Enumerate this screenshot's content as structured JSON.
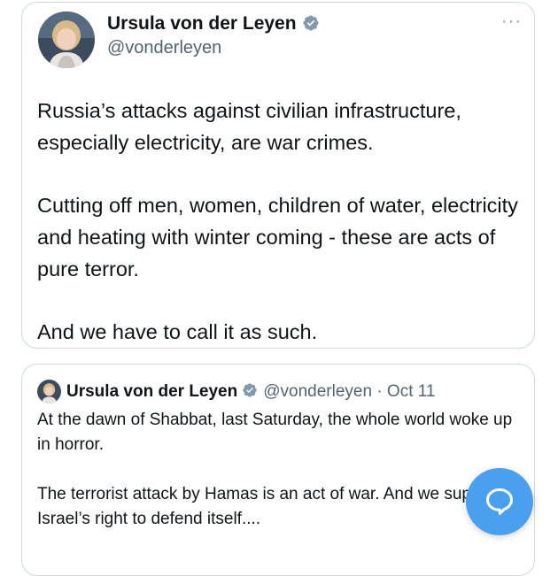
{
  "tweet": {
    "author_name": "Ursula von der Leyen",
    "handle": "@vonderleyen",
    "more_label": "···",
    "paragraphs": [
      "Russia’s attacks against civilian infrastructure, especially electricity, are war crimes.",
      "Cutting off men, women, children of water, electricity and heating with winter coming - these are acts of pure terror.",
      "And we have to call it as such."
    ]
  },
  "quoted_tweet": {
    "author_name": "Ursula von der Leyen",
    "handle_date": "@vonderleyen · Oct 11",
    "paragraphs": [
      "At the dawn of Shabbat, last Saturday, the whole world woke up in horror.",
      "The terrorist attack by Hamas is an act of war. And we support Israel’s right to defend itself...."
    ]
  },
  "icons": {
    "verified": "verified-badge-icon",
    "more": "more-options-icon",
    "fab": "chat-bubble-icon"
  },
  "colors": {
    "verified_badge": "#829aab",
    "fab": "#4aa0ec",
    "secondary_text": "#536471",
    "border": "#cfd9de"
  }
}
